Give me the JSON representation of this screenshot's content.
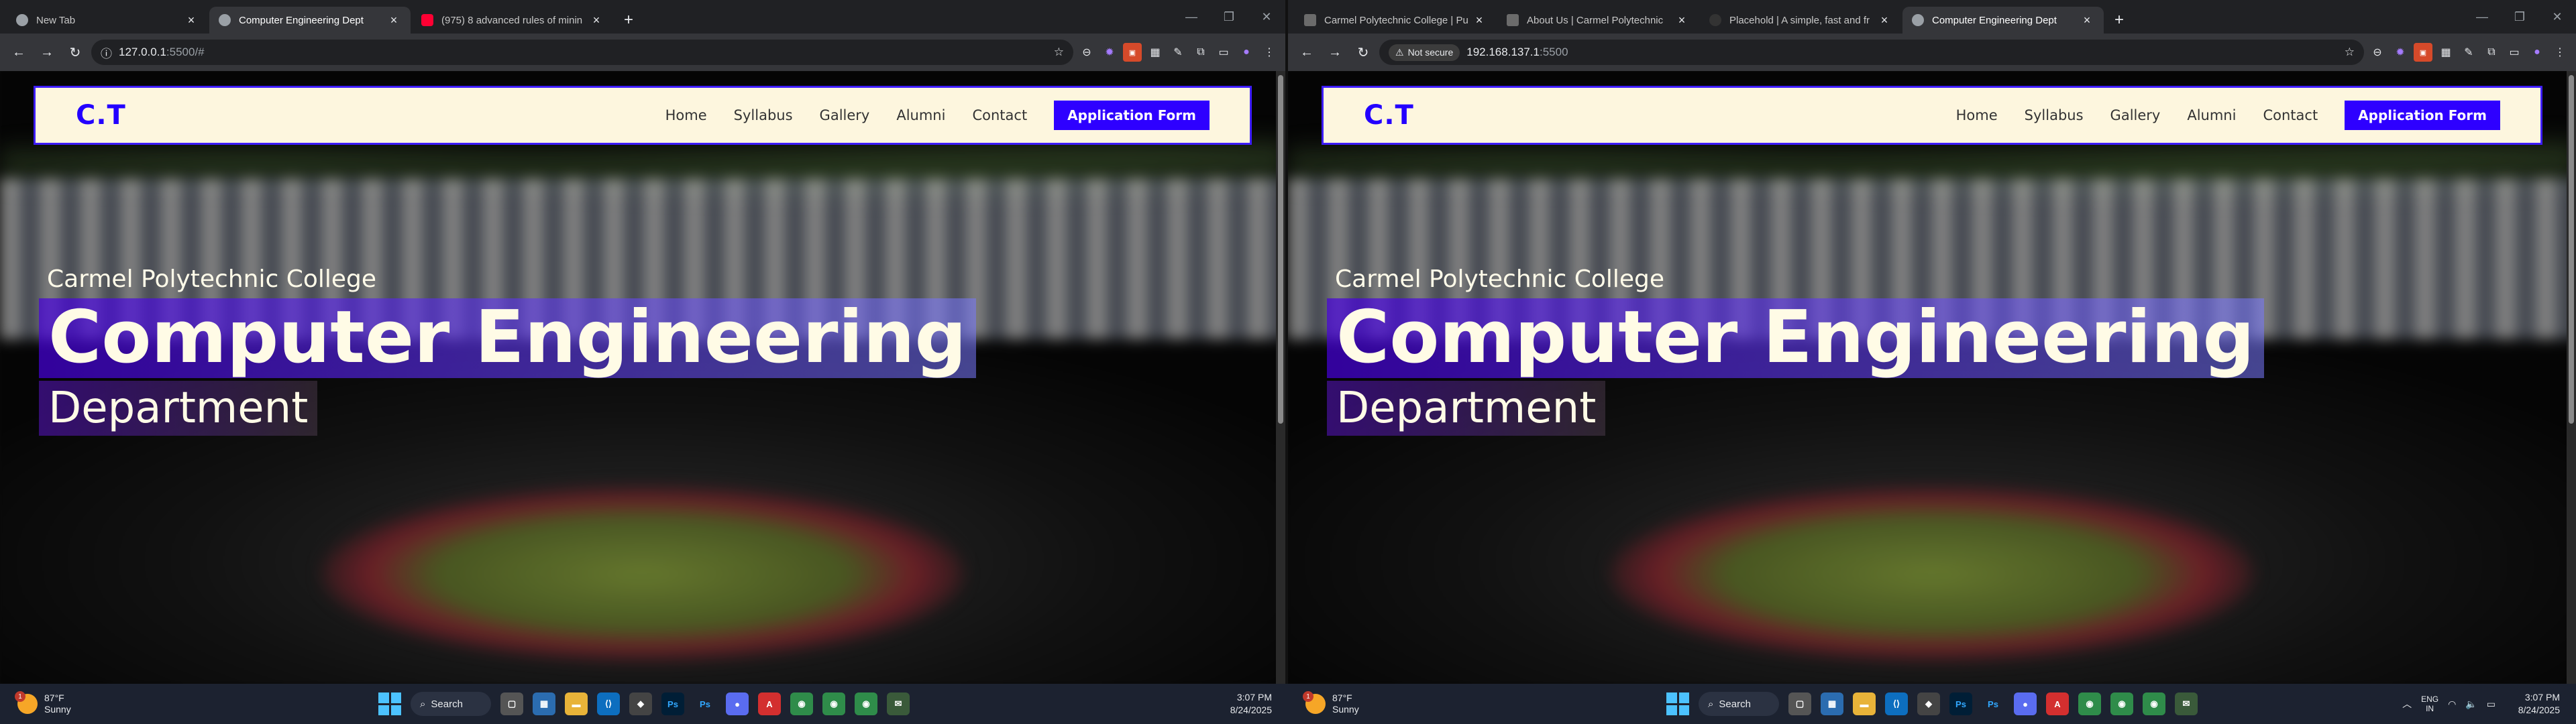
{
  "left_browser": {
    "tabs": [
      {
        "title": "New Tab",
        "icon": "chrome-icon",
        "active": false
      },
      {
        "title": "Computer Engineering Dept",
        "icon": "globe-icon",
        "active": true
      },
      {
        "title": "(975) 8 advanced rules of minin",
        "icon": "youtube-icon",
        "active": false
      }
    ],
    "url_host": "127.0.0.1",
    "url_path": ":5500/#"
  },
  "right_browser": {
    "tabs": [
      {
        "title": "Carmel Polytechnic College | Pu",
        "icon": "cpc-icon",
        "active": false
      },
      {
        "title": "About Us | Carmel Polytechnic",
        "icon": "cpc-icon",
        "active": false
      },
      {
        "title": "Placehold | A simple, fast and fr",
        "icon": "placehold-icon",
        "active": false
      },
      {
        "title": "Computer Engineering Dept",
        "icon": "globe-icon",
        "active": true
      }
    ],
    "not_secure": "Not secure",
    "url_host": "192.168.137.1",
    "url_path": ":5500"
  },
  "site": {
    "logo": "C.T",
    "nav": [
      "Home",
      "Syllabus",
      "Gallery",
      "Alumni",
      "Contact"
    ],
    "cta": "Application Form",
    "hero_sub": "Carmel Polytechnic College",
    "hero_title": "Computer Engineering",
    "hero_dept": "Department"
  },
  "taskbar": {
    "temp": "87°F",
    "condition": "Sunny",
    "weather_badge": "1",
    "search": "Search",
    "time": "3:07 PM",
    "date": "8/24/2025",
    "lang_1": "ENG",
    "lang_2": "IN"
  },
  "colors": {
    "accent": "#2e00ff",
    "nav_bg": "#fdf6de",
    "border": "#3d1cff"
  }
}
